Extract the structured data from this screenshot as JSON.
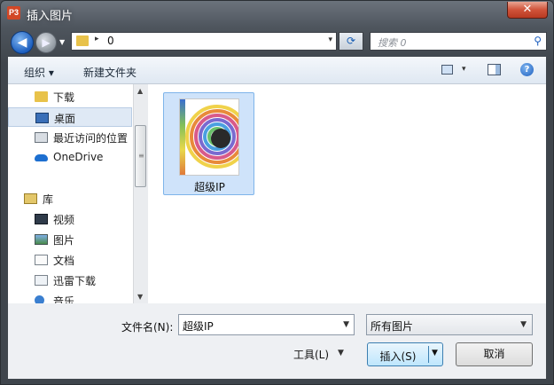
{
  "window": {
    "app_icon_text": "P3",
    "title": "插入图片",
    "close_glyph": "✕"
  },
  "address_bar": {
    "path_arrow": "▸",
    "path": "0",
    "dropdown_glyph": "▾",
    "refresh_glyph": "⟳"
  },
  "search": {
    "placeholder": "搜索 0",
    "icon": "search-icon"
  },
  "toolbar": {
    "organize_label": "组织 ▾",
    "new_folder_label": "新建文件夹",
    "view_dropdown_glyph": "▾",
    "help_glyph": "?"
  },
  "nav": {
    "items": [
      {
        "label": "下载",
        "icon": "downloads-folder-icon"
      },
      {
        "label": "桌面",
        "icon": "desktop-icon",
        "selected": true
      },
      {
        "label": "最近访问的位置",
        "icon": "recent-places-icon"
      },
      {
        "label": "OneDrive",
        "icon": "onedrive-icon"
      },
      {
        "label": "库",
        "icon": "library-icon"
      },
      {
        "label": "视频",
        "icon": "videos-icon"
      },
      {
        "label": "图片",
        "icon": "pictures-icon"
      },
      {
        "label": "文档",
        "icon": "documents-icon"
      },
      {
        "label": "迅雷下载",
        "icon": "thunder-download-icon"
      },
      {
        "label": "音乐",
        "icon": "music-icon"
      }
    ]
  },
  "files": [
    {
      "name": "超级IP",
      "selected": true
    }
  ],
  "bottom": {
    "filename_label": "文件名(N):",
    "filename_value": "超级IP",
    "filetype_value": "所有图片",
    "tools_label": "工具(L)",
    "insert_label": "插入(S)",
    "cancel_label": "取消"
  },
  "colors": {
    "selection": "#cfe3fa",
    "accent": "#1d5fbf",
    "close": "#d0533a"
  }
}
